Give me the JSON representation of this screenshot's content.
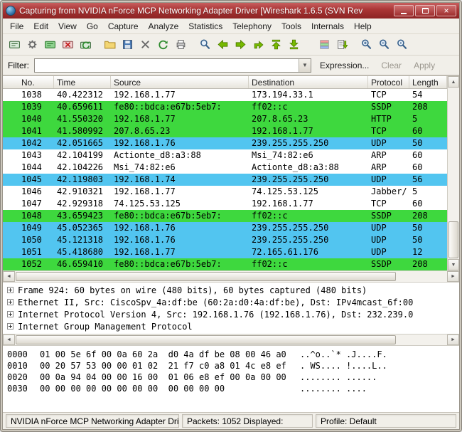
{
  "window": {
    "title": "Capturing from NVIDIA nForce MCP Networking Adapter Driver    [Wireshark 1.6.5 (SVN Rev"
  },
  "menu": {
    "items": [
      "File",
      "Edit",
      "View",
      "Go",
      "Capture",
      "Analyze",
      "Statistics",
      "Telephony",
      "Tools",
      "Internals",
      "Help"
    ]
  },
  "toolbar": {
    "icons": [
      "list-interfaces",
      "capture-options",
      "capture-start",
      "capture-stop",
      "capture-restart",
      "open-file",
      "save-file",
      "close-file",
      "reload",
      "print",
      "find-packet",
      "go-back",
      "go-forward",
      "go-to-packet",
      "go-to-top",
      "go-to-bottom",
      "colorize",
      "auto-scroll",
      "zoom-in",
      "zoom-out",
      "zoom-100"
    ]
  },
  "filter": {
    "label": "Filter:",
    "value": "",
    "expression": "Expression...",
    "clear": "Clear",
    "apply": "Apply"
  },
  "packet_list": {
    "columns": [
      "No.",
      "Time",
      "Source",
      "Destination",
      "Protocol",
      "Length"
    ],
    "rows": [
      {
        "no": "1038",
        "time": "40.422312",
        "source": "192.168.1.77",
        "destination": "173.194.33.1",
        "protocol": "TCP",
        "length": "54",
        "color": "white"
      },
      {
        "no": "1039",
        "time": "40.659611",
        "source": "fe80::bdca:e67b:5eb7:",
        "destination": "ff02::c",
        "protocol": "SSDP",
        "length": "208",
        "color": "green"
      },
      {
        "no": "1040",
        "time": "41.550320",
        "source": "192.168.1.77",
        "destination": "207.8.65.23",
        "protocol": "HTTP",
        "length": "5",
        "color": "green"
      },
      {
        "no": "1041",
        "time": "41.580992",
        "source": "207.8.65.23",
        "destination": "192.168.1.77",
        "protocol": "TCP",
        "length": "60",
        "color": "green"
      },
      {
        "no": "1042",
        "time": "42.051665",
        "source": "192.168.1.76",
        "destination": "239.255.255.250",
        "protocol": "UDP",
        "length": "50",
        "color": "blue"
      },
      {
        "no": "1043",
        "time": "42.104199",
        "source": "Actionte_d8:a3:88",
        "destination": "Msi_74:82:e6",
        "protocol": "ARP",
        "length": "60",
        "color": "white"
      },
      {
        "no": "1044",
        "time": "42.104226",
        "source": "Msi_74:82:e6",
        "destination": "Actionte_d8:a3:88",
        "protocol": "ARP",
        "length": "60",
        "color": "white"
      },
      {
        "no": "1045",
        "time": "42.119803",
        "source": "192.168.1.74",
        "destination": "239.255.255.250",
        "protocol": "UDP",
        "length": "56",
        "color": "blue"
      },
      {
        "no": "1046",
        "time": "42.910321",
        "source": "192.168.1.77",
        "destination": "74.125.53.125",
        "protocol": "Jabber/",
        "length": "5",
        "color": "white"
      },
      {
        "no": "1047",
        "time": "42.929318",
        "source": "74.125.53.125",
        "destination": "192.168.1.77",
        "protocol": "TCP",
        "length": "60",
        "color": "white"
      },
      {
        "no": "1048",
        "time": "43.659423",
        "source": "fe80::bdca:e67b:5eb7:",
        "destination": "ff02::c",
        "protocol": "SSDP",
        "length": "208",
        "color": "green"
      },
      {
        "no": "1049",
        "time": "45.052365",
        "source": "192.168.1.76",
        "destination": "239.255.255.250",
        "protocol": "UDP",
        "length": "50",
        "color": "blue"
      },
      {
        "no": "1050",
        "time": "45.121318",
        "source": "192.168.1.76",
        "destination": "239.255.255.250",
        "protocol": "UDP",
        "length": "50",
        "color": "blue"
      },
      {
        "no": "1051",
        "time": "45.418680",
        "source": "192.168.1.77",
        "destination": "72.165.61.176",
        "protocol": "UDP",
        "length": "12",
        "color": "blue"
      },
      {
        "no": "1052",
        "time": "46.659410",
        "source": "fe80::bdca:e67b:5eb7:",
        "destination": "ff02::c",
        "protocol": "SSDP",
        "length": "208",
        "color": "green"
      }
    ]
  },
  "details": {
    "lines": [
      "Frame 924: 60 bytes on wire (480 bits), 60 bytes captured (480 bits)",
      "Ethernet II, Src: CiscoSpv_4a:df:be (60:2a:d0:4a:df:be), Dst: IPv4mcast_6f:00",
      "Internet Protocol Version 4, Src: 192.168.1.76 (192.168.1.76), Dst: 232.239.0",
      "Internet Group Management Protocol"
    ]
  },
  "hex_dump": {
    "lines": [
      {
        "offset": "0000",
        "hex": "01 00 5e 6f 00 0a 60 2a  d0 4a df be 08 00 46 a0",
        "ascii": "..^o..`* .J....F."
      },
      {
        "offset": "0010",
        "hex": "00 20 57 53 00 00 01 02  21 f7 c0 a8 01 4c e8 ef",
        "ascii": ". WS.... !....L.."
      },
      {
        "offset": "0020",
        "hex": "00 0a 94 04 00 00 16 00  01 06 e8 ef 00 0a 00 00",
        "ascii": "........ ......"
      },
      {
        "offset": "0030",
        "hex": "00 00 00 00 00 00 00 00  00 00 00 00",
        "ascii": "........ ...."
      }
    ]
  },
  "status_bar": {
    "adapter": "NVIDIA nForce MCP Networking Adapter Driv",
    "packets": "Packets: 1052 Displayed:",
    "profile": "Profile: Default"
  },
  "colors": {
    "titlebar_red": "#a93434",
    "row_green": "#3ed83e",
    "row_blue": "#52c5f0",
    "row_white": "#ffffff"
  }
}
